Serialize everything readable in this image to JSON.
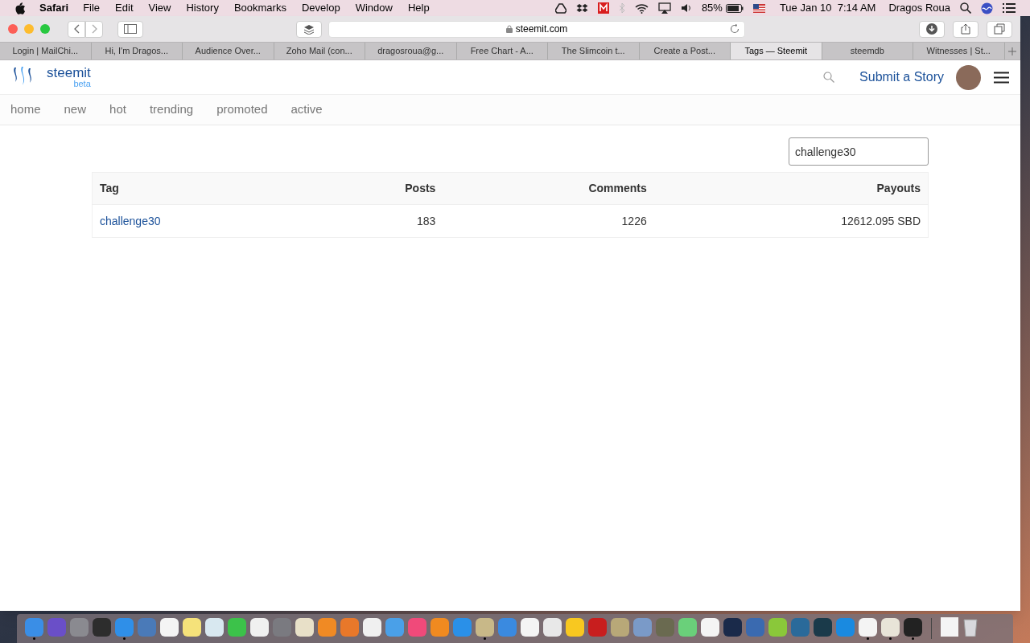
{
  "menu_bar": {
    "app_name": "Safari",
    "menus": [
      "File",
      "Edit",
      "View",
      "History",
      "Bookmarks",
      "Develop",
      "Window",
      "Help"
    ],
    "battery": "85%",
    "clock": "Tue Jan 10  7:14 AM",
    "user": "Dragos Roua"
  },
  "browser": {
    "url": "steemit.com",
    "tabs": [
      {
        "label": "Login | MailChi...",
        "selected": false
      },
      {
        "label": "Hi, I'm Dragos...",
        "selected": false
      },
      {
        "label": "Audience Over...",
        "selected": false
      },
      {
        "label": "Zoho Mail (con...",
        "selected": false
      },
      {
        "label": "dragosroua@g...",
        "selected": false
      },
      {
        "label": "Free Chart - A...",
        "selected": false
      },
      {
        "label": "The Slimcoin t...",
        "selected": false
      },
      {
        "label": "Create a Post...",
        "selected": false
      },
      {
        "label": "Tags — Steemit",
        "selected": true
      },
      {
        "label": "steemdb",
        "selected": false
      },
      {
        "label": "Witnesses | St...",
        "selected": false
      }
    ]
  },
  "site": {
    "logo": "steemit",
    "logo_sub": "beta",
    "submit": "Submit a Story",
    "nav": [
      "home",
      "new",
      "hot",
      "trending",
      "promoted",
      "active"
    ],
    "search_value": "challenge30",
    "table": {
      "columns": [
        "Tag",
        "Posts",
        "Comments",
        "Payouts"
      ],
      "rows": [
        [
          "challenge30",
          "183",
          "1226",
          "12612.095 SBD"
        ]
      ]
    }
  },
  "dock": {
    "apps": [
      {
        "running": true
      },
      {
        "running": false
      },
      {
        "running": false
      },
      {
        "running": false
      },
      {
        "running": true
      },
      {
        "running": false
      },
      {
        "running": false
      },
      {
        "running": false
      },
      {
        "running": false
      },
      {
        "running": false
      },
      {
        "running": false
      },
      {
        "running": false
      },
      {
        "running": false
      },
      {
        "running": false
      },
      {
        "running": false
      },
      {
        "running": false
      },
      {
        "running": false
      },
      {
        "running": false
      },
      {
        "running": false
      },
      {
        "running": false
      },
      {
        "running": true
      },
      {
        "running": false
      },
      {
        "running": false
      },
      {
        "running": false
      },
      {
        "running": false
      },
      {
        "running": false
      },
      {
        "running": false
      },
      {
        "running": false
      },
      {
        "running": false
      },
      {
        "running": false
      },
      {
        "running": false
      },
      {
        "running": false
      },
      {
        "running": false
      },
      {
        "running": false
      },
      {
        "running": false
      },
      {
        "running": false
      },
      {
        "running": false
      },
      {
        "running": true
      },
      {
        "running": true
      },
      {
        "running": true
      }
    ]
  }
}
